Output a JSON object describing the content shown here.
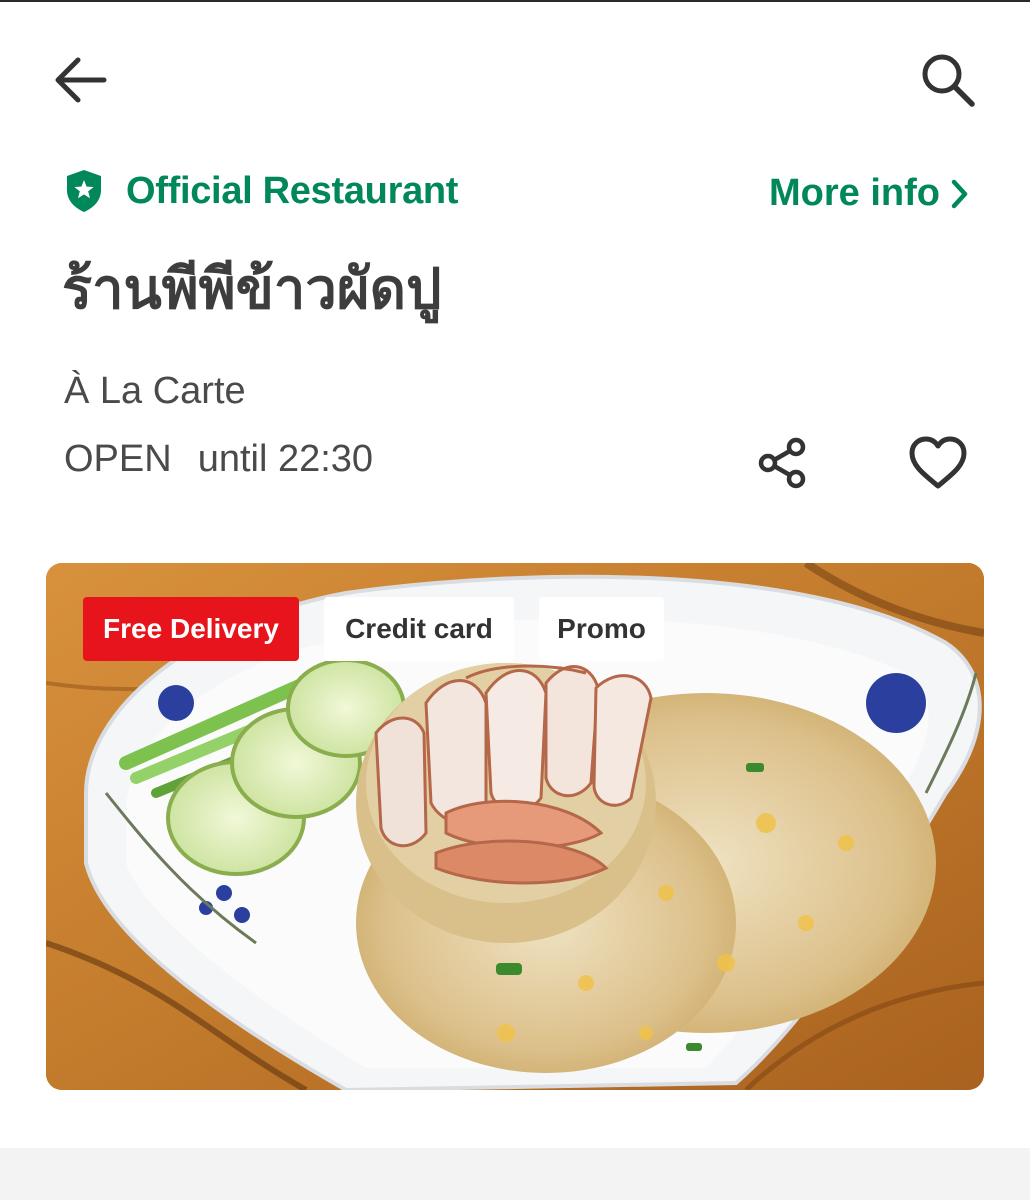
{
  "header": {
    "back_icon": "arrow-left-icon",
    "search_icon": "search-icon"
  },
  "restaurant": {
    "badge_icon": "shield-star-icon",
    "official_label": "Official Restaurant",
    "more_info_label": "More info",
    "more_info_icon": "chevron-right-icon",
    "name": "ร้านพีพีข้าวผัดปู",
    "category": "À La Carte",
    "status": "OPEN",
    "hours": "until 22:30",
    "share_icon": "share-icon",
    "favorite_icon": "heart-outline-icon"
  },
  "hero": {
    "image_subject": "crab fried rice plate",
    "tags": {
      "free_delivery": "Free Delivery",
      "credit_card": "Credit card",
      "promo": "Promo"
    }
  },
  "colors": {
    "brand_green": "#00875a",
    "free_delivery_red": "#e8141b",
    "text_dark": "#3d3d3d"
  }
}
